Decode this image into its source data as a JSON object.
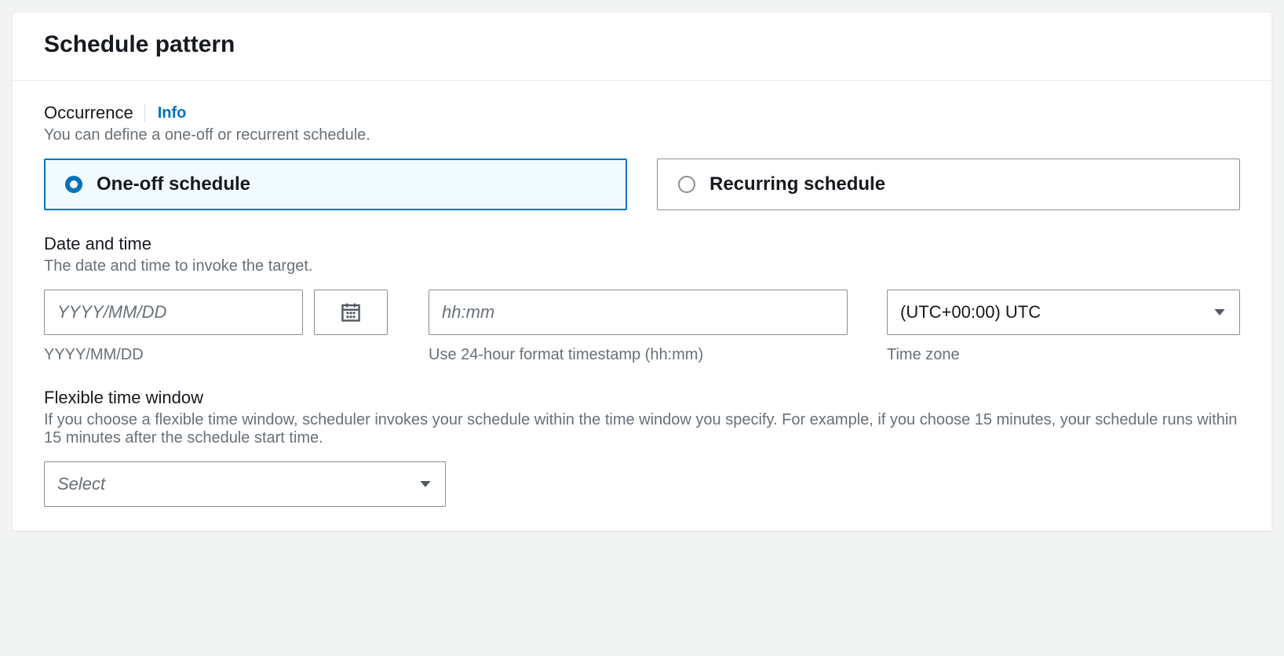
{
  "panel": {
    "title": "Schedule pattern"
  },
  "occurrence": {
    "label": "Occurrence",
    "info": "Info",
    "description": "You can define a one-off or recurrent schedule.",
    "options": {
      "one_off": "One-off schedule",
      "recurring": "Recurring schedule"
    }
  },
  "datetime": {
    "label": "Date and time",
    "description": "The date and time to invoke the target.",
    "date_placeholder": "YYYY/MM/DD",
    "date_hint": "YYYY/MM/DD",
    "time_placeholder": "hh:mm",
    "time_hint": "Use 24-hour format timestamp (hh:mm)",
    "timezone_value": "(UTC+00:00) UTC",
    "timezone_hint": "Time zone"
  },
  "flex_window": {
    "label": "Flexible time window",
    "description": "If you choose a flexible time window, scheduler invokes your schedule within the time window you specify. For example, if you choose 15 minutes, your schedule runs within 15 minutes after the schedule start time.",
    "placeholder": "Select"
  }
}
